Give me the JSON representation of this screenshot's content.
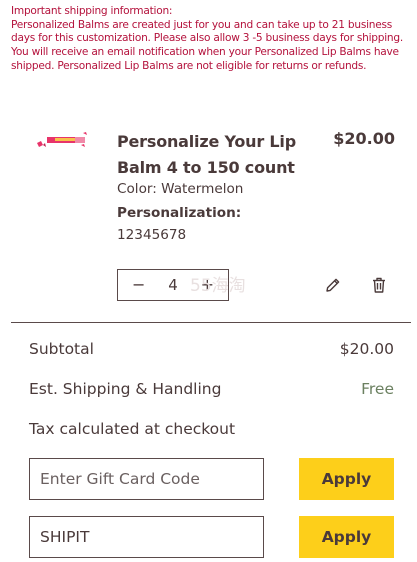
{
  "notice": {
    "heading": "Important shipping information:",
    "body": "Personalized Balms are created just for you and can take up to 21 business days for this customization. Please also allow 3 -5 business days for shipping. You will receive an email notification when your Personalized Lip Balms have shipped. Personalized Lip Balms are not eligible for returns or refunds."
  },
  "item": {
    "title": "Personalize Your Lip Balm 4 to 150 count",
    "price": "$20.00",
    "color": "Color: Watermelon",
    "personalization_label": "Personalization:",
    "personalization_value": "12345678",
    "quantity": "4",
    "minus_label": "−",
    "plus_label": "+"
  },
  "watermark": "55海淘",
  "summary": {
    "subtotal_label": "Subtotal",
    "subtotal_value": "$20.00",
    "shipping_label": "Est. Shipping & Handling",
    "shipping_value": "Free",
    "tax_label": "Tax calculated at checkout"
  },
  "gift_card": {
    "placeholder": "Enter Gift Card Code",
    "value": "",
    "apply_label": "Apply"
  },
  "promo": {
    "value": "SHIPIT",
    "apply_label": "Apply"
  },
  "colors": {
    "notice_text": "#b4123c",
    "apply_button": "#fdcf1a",
    "free_text": "#6b8060",
    "body_text": "#4a3a3a"
  },
  "icons": {
    "edit": "pencil-icon",
    "delete": "trash-icon"
  }
}
